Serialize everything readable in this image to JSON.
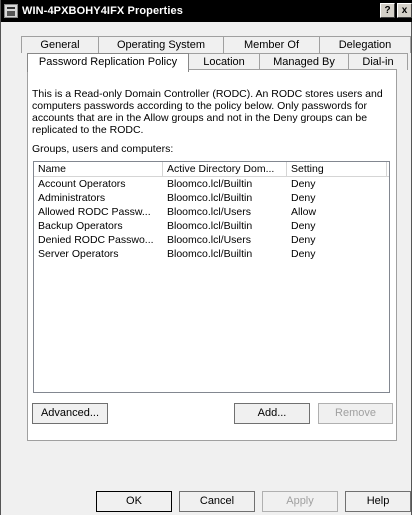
{
  "window": {
    "title": "WIN-4PXBOHY4IFX Properties",
    "help_glyph": "?",
    "close_glyph": "x"
  },
  "tabs": {
    "row_back": [
      "General",
      "Operating System",
      "Member Of",
      "Delegation"
    ],
    "row_front": [
      "Password Replication Policy",
      "Location",
      "Managed By",
      "Dial-in"
    ],
    "active": "Password Replication Policy"
  },
  "policy": {
    "description": "This is a Read-only Domain Controller (RODC).  An RODC stores users and computers passwords according to the policy below.  Only passwords for accounts that are in the Allow groups and not in the Deny groups can be replicated to the RODC.",
    "groups_label": "Groups, users and computers:",
    "columns": [
      "Name",
      "Active Directory Dom...",
      "Setting"
    ],
    "rows": [
      [
        "Account Operators",
        "Bloomco.lcl/Builtin",
        "Deny"
      ],
      [
        "Administrators",
        "Bloomco.lcl/Builtin",
        "Deny"
      ],
      [
        "Allowed RODC Passw...",
        "Bloomco.lcl/Users",
        "Allow"
      ],
      [
        "Backup Operators",
        "Bloomco.lcl/Builtin",
        "Deny"
      ],
      [
        "Denied RODC Passwo...",
        "Bloomco.lcl/Users",
        "Deny"
      ],
      [
        "Server Operators",
        "Bloomco.lcl/Builtin",
        "Deny"
      ]
    ],
    "advanced_label": "Advanced...",
    "add_label": "Add...",
    "remove_label": "Remove"
  },
  "footer": {
    "ok": "OK",
    "cancel": "Cancel",
    "apply": "Apply",
    "help": "Help"
  }
}
